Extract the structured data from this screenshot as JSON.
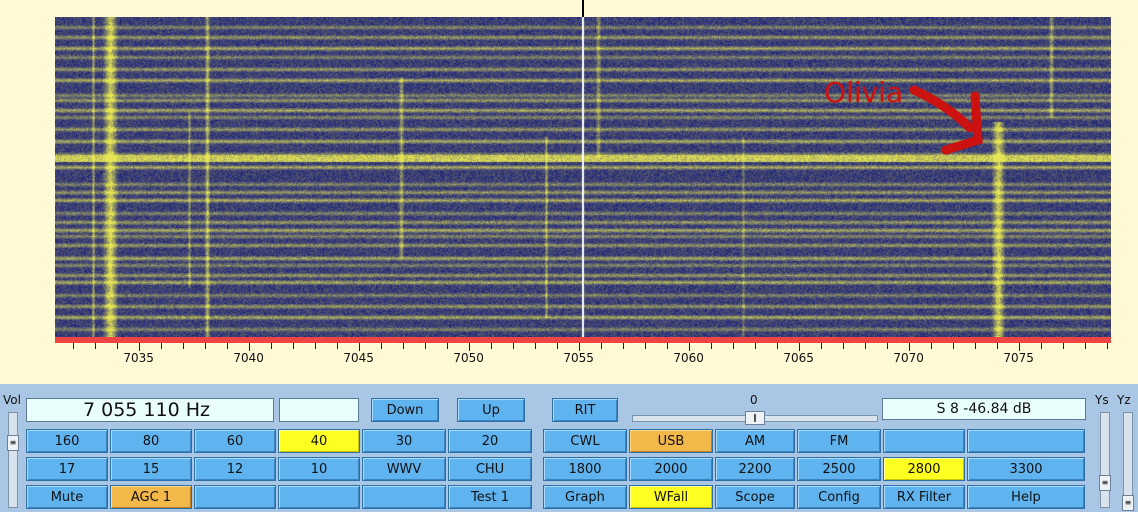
{
  "waterfall": {
    "freq_axis": {
      "labels": [
        "7035",
        "7040",
        "7045",
        "7050",
        "7055",
        "7060",
        "7065",
        "7070",
        "7075"
      ],
      "start_khz": 7031.2,
      "end_khz": 7079.2
    },
    "annotation": "Olivia",
    "colors": {
      "background": "#1a1f7a",
      "signal": "#e6e655",
      "cursor": "#ffffff",
      "annotation": "#cc1111"
    }
  },
  "controls": {
    "vol_label": "Vol",
    "ys_label": "Ys",
    "yz_label": "Yz",
    "frequency": "7 055 110 Hz",
    "aux_display": "",
    "down_label": "Down",
    "up_label": "Up",
    "rit_label": "RIT",
    "rit_value": "0",
    "s_meter": "S 8   -46.84 dB",
    "bands": {
      "b160": "160",
      "b80": "80",
      "b60": "60",
      "b40": "40",
      "b30": "30",
      "b20": "20",
      "b17": "17",
      "b15": "15",
      "b12": "12",
      "b10": "10",
      "wwv": "WWV",
      "chu": "CHU",
      "mute": "Mute",
      "agc": "AGC 1",
      "blank1": "",
      "blank2": "",
      "blank3": "",
      "test": "Test 1"
    },
    "modes": {
      "cwl": "CWL",
      "usb": "USB",
      "am": "AM",
      "fm": "FM",
      "blank4": "",
      "blank5": "",
      "f1800": "1800",
      "f2000": "2000",
      "f2200": "2200",
      "f2500": "2500",
      "f2800": "2800",
      "f3300": "3300",
      "graph": "Graph",
      "wfall": "WFall",
      "scope": "Scope",
      "config": "Config",
      "rxfilter": "RX Filter",
      "help": "Help"
    },
    "active": {
      "band": "40",
      "agc": "AGC 1",
      "mode": "USB",
      "filter": "2800",
      "display": "WFall"
    }
  }
}
